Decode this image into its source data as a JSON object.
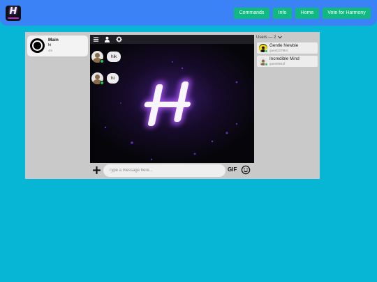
{
  "app": {
    "logo_letter": "H",
    "accent_color": "#10b981",
    "topbar_color": "#3b82f6",
    "background_color": "#06b6d4"
  },
  "nav": {
    "commands": "Commands",
    "info": "Info",
    "home": "Home",
    "vote": "Vote for Harmony"
  },
  "servers": [
    {
      "name": "Main",
      "last_message": "hi",
      "time": "4m"
    }
  ],
  "chat_toolbar": {
    "icons": [
      "menu-icon",
      "users-icon",
      "gear-icon"
    ]
  },
  "chat": {
    "background_logo_letter": "H",
    "messages": [
      {
        "text": "hik"
      },
      {
        "text": "hi"
      }
    ]
  },
  "composer": {
    "placeholder": "Type a message here...",
    "gif_label": "GIF"
  },
  "users": {
    "header": "Users — 2",
    "list": [
      {
        "name": "Gentle Newbie",
        "id": "guest2279h4"
      },
      {
        "name": "Incredible Mind",
        "id": "guest0942f"
      }
    ]
  }
}
